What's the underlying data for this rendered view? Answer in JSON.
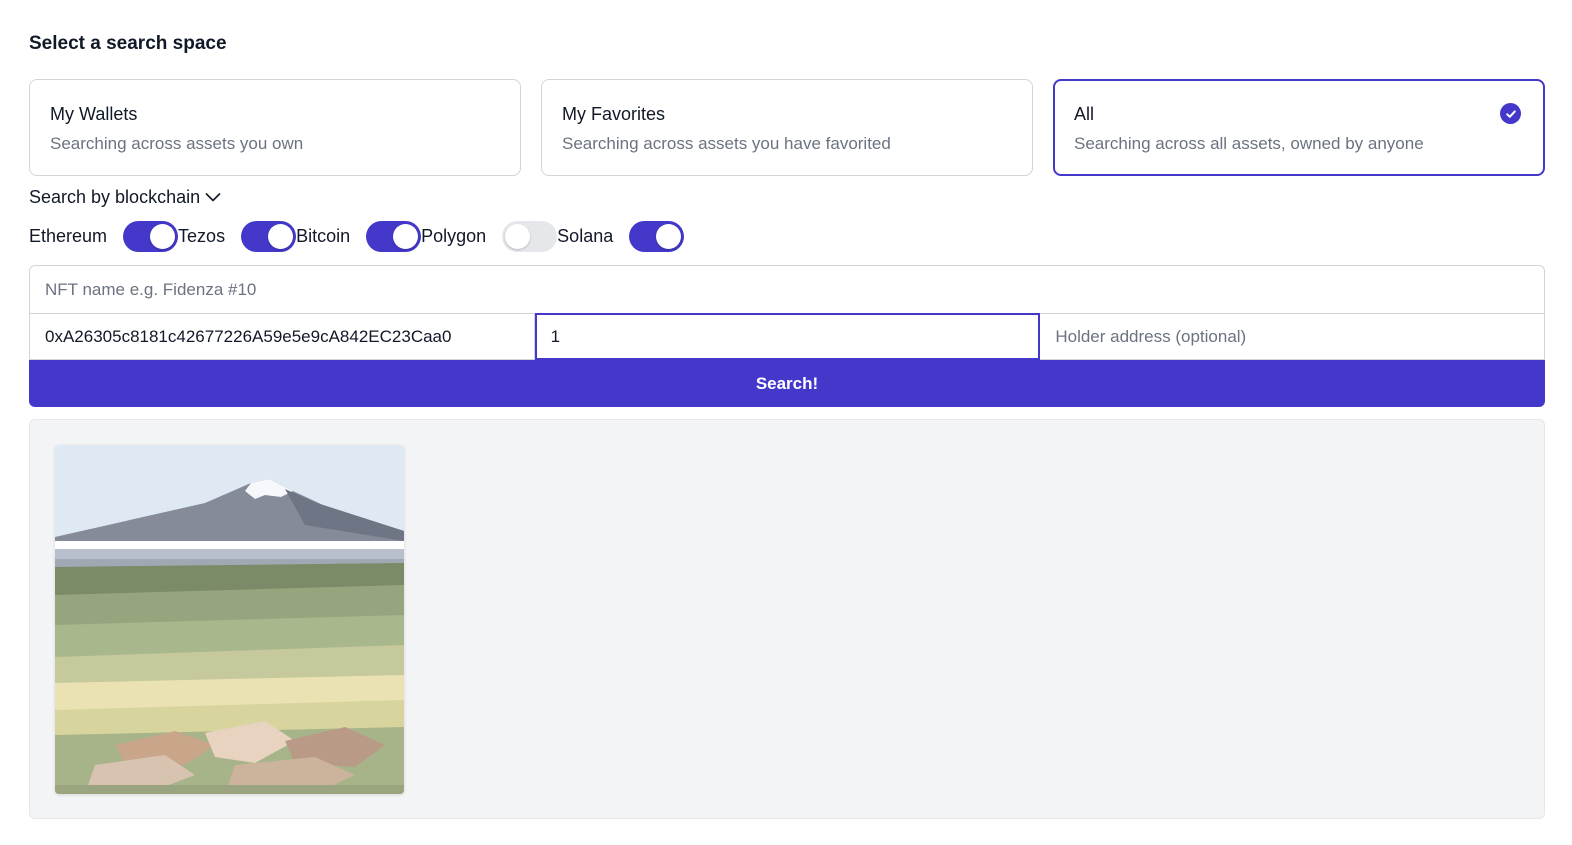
{
  "search_space": {
    "title": "Select a search space",
    "options": [
      {
        "title": "My Wallets",
        "description": "Searching across assets you own",
        "selected": false
      },
      {
        "title": "My Favorites",
        "description": "Searching across assets you have favorited",
        "selected": false
      },
      {
        "title": "All",
        "description": "Searching across all assets, owned by anyone",
        "selected": true
      }
    ]
  },
  "blockchain": {
    "toggle_label": "Search by blockchain",
    "chains": [
      {
        "name": "Ethereum",
        "enabled": true
      },
      {
        "name": "Tezos",
        "enabled": true
      },
      {
        "name": "Bitcoin",
        "enabled": true
      },
      {
        "name": "Polygon",
        "enabled": false
      },
      {
        "name": "Solana",
        "enabled": true
      }
    ]
  },
  "form": {
    "name_placeholder": "NFT name e.g. Fidenza #10",
    "name_value": "",
    "contract_value": "0xA26305c8181c42677226A59e5e9cA842EC23Caa0",
    "token_id_value": "1",
    "holder_placeholder": "Holder address (optional)",
    "holder_value": "",
    "search_label": "Search!"
  },
  "colors": {
    "accent": "#4338ca",
    "border": "#d1d5db",
    "muted_text": "#6b7280",
    "results_bg": "#f3f4f6"
  },
  "results": {
    "items": [
      {
        "kind": "nft-image",
        "depicts": "landscape-icon"
      }
    ]
  }
}
